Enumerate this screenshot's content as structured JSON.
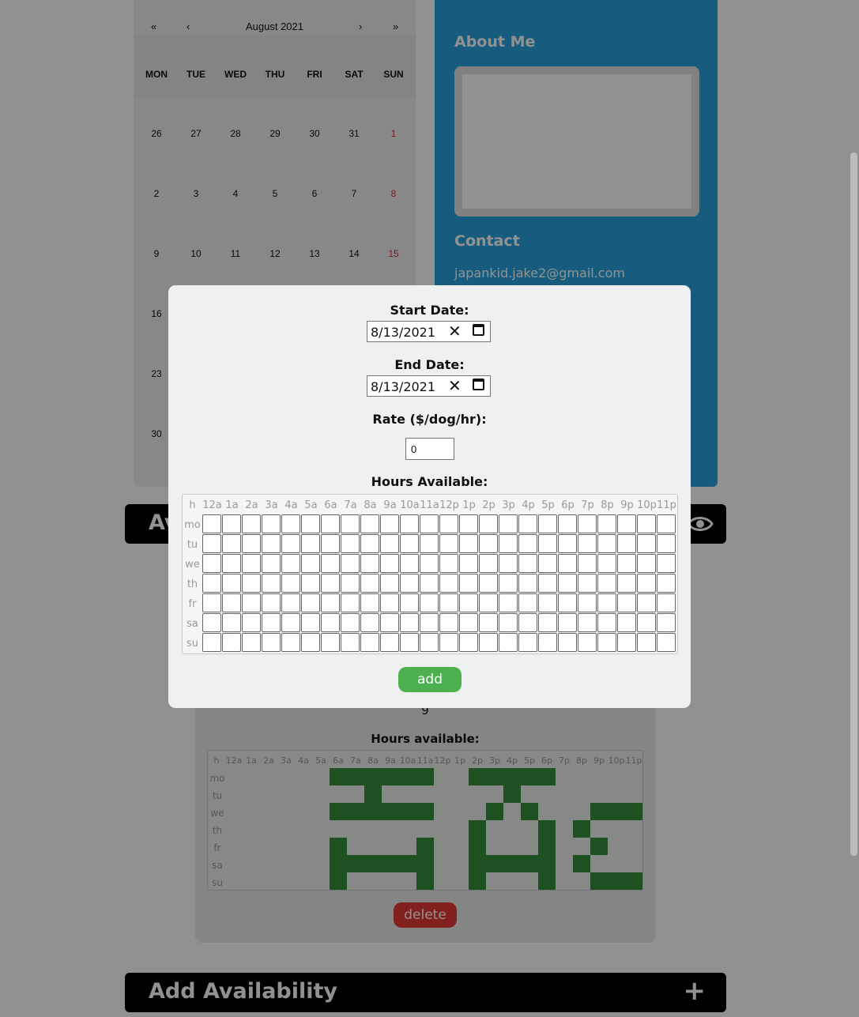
{
  "calendar": {
    "nav_prev_year": "«",
    "nav_prev_month": "‹",
    "month_label": "August 2021",
    "nav_next_month": "›",
    "nav_next_year": "»",
    "weekdays": [
      "MON",
      "TUE",
      "WED",
      "THU",
      "FRI",
      "SAT",
      "SUN"
    ],
    "weeks": [
      [
        "26",
        "27",
        "28",
        "29",
        "30",
        "31",
        "1"
      ],
      [
        "2",
        "3",
        "4",
        "5",
        "6",
        "7",
        "8"
      ],
      [
        "9",
        "10",
        "11",
        "12",
        "13",
        "14",
        "15"
      ],
      [
        "16"
      ],
      [
        "23"
      ],
      [
        "30"
      ]
    ],
    "sunday_color": "#d32f2f"
  },
  "profile": {
    "about_heading": "About Me",
    "contact_heading": "Contact",
    "email": "japankid.jake2@gmail.com",
    "background_color": "#2aa3de"
  },
  "availability_bar": {
    "title": "Av",
    "icon": "eye-icon"
  },
  "availability_card": {
    "rate": "9",
    "hours_label": "Hours available:",
    "delete_label": "delete",
    "hour_labels": [
      "h",
      "12a",
      "1a",
      "2a",
      "3a",
      "4a",
      "5a",
      "6a",
      "7a",
      "8a",
      "9a",
      "10a",
      "11a",
      "12p",
      "1p",
      "2p",
      "3p",
      "4p",
      "5p",
      "6p",
      "7p",
      "8p",
      "9p",
      "10p",
      "11p"
    ],
    "day_labels": [
      "mo",
      "tu",
      "we",
      "th",
      "fr",
      "sa",
      "su"
    ],
    "filled_color": "#388e3c",
    "schedule": [
      [
        0,
        0,
        0,
        0,
        0,
        0,
        1,
        1,
        1,
        1,
        1,
        1,
        0,
        0,
        1,
        1,
        1,
        1,
        1,
        0,
        0,
        0,
        0,
        0
      ],
      [
        0,
        0,
        0,
        0,
        0,
        0,
        0,
        0,
        1,
        0,
        0,
        0,
        0,
        0,
        0,
        0,
        1,
        0,
        0,
        0,
        0,
        0,
        0,
        0
      ],
      [
        0,
        0,
        0,
        0,
        0,
        0,
        1,
        1,
        1,
        1,
        1,
        1,
        0,
        0,
        0,
        1,
        0,
        1,
        0,
        0,
        0,
        1,
        1,
        1
      ],
      [
        0,
        0,
        0,
        0,
        0,
        0,
        0,
        0,
        0,
        0,
        0,
        0,
        0,
        0,
        1,
        0,
        0,
        0,
        1,
        0,
        1,
        0,
        0,
        0
      ],
      [
        0,
        0,
        0,
        0,
        0,
        0,
        1,
        0,
        0,
        0,
        0,
        1,
        0,
        0,
        1,
        0,
        0,
        0,
        1,
        0,
        0,
        1,
        0,
        0
      ],
      [
        0,
        0,
        0,
        0,
        0,
        0,
        1,
        1,
        1,
        1,
        1,
        1,
        0,
        0,
        1,
        1,
        1,
        1,
        1,
        0,
        1,
        0,
        0,
        0
      ],
      [
        0,
        0,
        0,
        0,
        0,
        0,
        1,
        0,
        0,
        0,
        0,
        1,
        0,
        0,
        1,
        0,
        0,
        0,
        1,
        0,
        0,
        1,
        1,
        1
      ]
    ]
  },
  "add_availability_bar": {
    "title": "Add Availability",
    "plus": "+"
  },
  "modal": {
    "start_date_label": "Start Date:",
    "start_date_value": "8/13/2021",
    "end_date_label": "End Date:",
    "end_date_value": "8/13/2021",
    "rate_label": "Rate ($/dog/hr):",
    "rate_value": "0",
    "hours_label": "Hours Available:",
    "hour_labels": [
      "h",
      "12a",
      "1a",
      "2a",
      "3a",
      "4a",
      "5a",
      "6a",
      "7a",
      "8a",
      "9a",
      "10a",
      "11a",
      "12p",
      "1p",
      "2p",
      "3p",
      "4p",
      "5p",
      "6p",
      "7p",
      "8p",
      "9p",
      "10p",
      "11p"
    ],
    "day_labels": [
      "mo",
      "tu",
      "we",
      "th",
      "fr",
      "sa",
      "su"
    ],
    "clear_glyph": "✕",
    "add_label": "add",
    "add_color": "#4caf50"
  }
}
